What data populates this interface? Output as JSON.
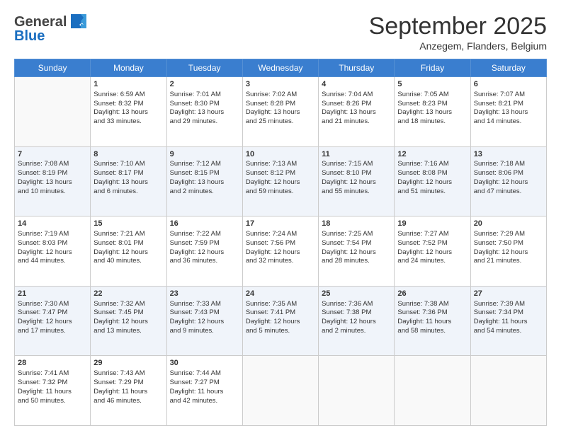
{
  "logo": {
    "text_general": "General",
    "text_blue": "Blue"
  },
  "title": "September 2025",
  "subtitle": "Anzegem, Flanders, Belgium",
  "days_of_week": [
    "Sunday",
    "Monday",
    "Tuesday",
    "Wednesday",
    "Thursday",
    "Friday",
    "Saturday"
  ],
  "weeks": [
    [
      {
        "day": "",
        "info": ""
      },
      {
        "day": "1",
        "info": "Sunrise: 6:59 AM\nSunset: 8:32 PM\nDaylight: 13 hours\nand 33 minutes."
      },
      {
        "day": "2",
        "info": "Sunrise: 7:01 AM\nSunset: 8:30 PM\nDaylight: 13 hours\nand 29 minutes."
      },
      {
        "day": "3",
        "info": "Sunrise: 7:02 AM\nSunset: 8:28 PM\nDaylight: 13 hours\nand 25 minutes."
      },
      {
        "day": "4",
        "info": "Sunrise: 7:04 AM\nSunset: 8:26 PM\nDaylight: 13 hours\nand 21 minutes."
      },
      {
        "day": "5",
        "info": "Sunrise: 7:05 AM\nSunset: 8:23 PM\nDaylight: 13 hours\nand 18 minutes."
      },
      {
        "day": "6",
        "info": "Sunrise: 7:07 AM\nSunset: 8:21 PM\nDaylight: 13 hours\nand 14 minutes."
      }
    ],
    [
      {
        "day": "7",
        "info": "Sunrise: 7:08 AM\nSunset: 8:19 PM\nDaylight: 13 hours\nand 10 minutes."
      },
      {
        "day": "8",
        "info": "Sunrise: 7:10 AM\nSunset: 8:17 PM\nDaylight: 13 hours\nand 6 minutes."
      },
      {
        "day": "9",
        "info": "Sunrise: 7:12 AM\nSunset: 8:15 PM\nDaylight: 13 hours\nand 2 minutes."
      },
      {
        "day": "10",
        "info": "Sunrise: 7:13 AM\nSunset: 8:12 PM\nDaylight: 12 hours\nand 59 minutes."
      },
      {
        "day": "11",
        "info": "Sunrise: 7:15 AM\nSunset: 8:10 PM\nDaylight: 12 hours\nand 55 minutes."
      },
      {
        "day": "12",
        "info": "Sunrise: 7:16 AM\nSunset: 8:08 PM\nDaylight: 12 hours\nand 51 minutes."
      },
      {
        "day": "13",
        "info": "Sunrise: 7:18 AM\nSunset: 8:06 PM\nDaylight: 12 hours\nand 47 minutes."
      }
    ],
    [
      {
        "day": "14",
        "info": "Sunrise: 7:19 AM\nSunset: 8:03 PM\nDaylight: 12 hours\nand 44 minutes."
      },
      {
        "day": "15",
        "info": "Sunrise: 7:21 AM\nSunset: 8:01 PM\nDaylight: 12 hours\nand 40 minutes."
      },
      {
        "day": "16",
        "info": "Sunrise: 7:22 AM\nSunset: 7:59 PM\nDaylight: 12 hours\nand 36 minutes."
      },
      {
        "day": "17",
        "info": "Sunrise: 7:24 AM\nSunset: 7:56 PM\nDaylight: 12 hours\nand 32 minutes."
      },
      {
        "day": "18",
        "info": "Sunrise: 7:25 AM\nSunset: 7:54 PM\nDaylight: 12 hours\nand 28 minutes."
      },
      {
        "day": "19",
        "info": "Sunrise: 7:27 AM\nSunset: 7:52 PM\nDaylight: 12 hours\nand 24 minutes."
      },
      {
        "day": "20",
        "info": "Sunrise: 7:29 AM\nSunset: 7:50 PM\nDaylight: 12 hours\nand 21 minutes."
      }
    ],
    [
      {
        "day": "21",
        "info": "Sunrise: 7:30 AM\nSunset: 7:47 PM\nDaylight: 12 hours\nand 17 minutes."
      },
      {
        "day": "22",
        "info": "Sunrise: 7:32 AM\nSunset: 7:45 PM\nDaylight: 12 hours\nand 13 minutes."
      },
      {
        "day": "23",
        "info": "Sunrise: 7:33 AM\nSunset: 7:43 PM\nDaylight: 12 hours\nand 9 minutes."
      },
      {
        "day": "24",
        "info": "Sunrise: 7:35 AM\nSunset: 7:41 PM\nDaylight: 12 hours\nand 5 minutes."
      },
      {
        "day": "25",
        "info": "Sunrise: 7:36 AM\nSunset: 7:38 PM\nDaylight: 12 hours\nand 2 minutes."
      },
      {
        "day": "26",
        "info": "Sunrise: 7:38 AM\nSunset: 7:36 PM\nDaylight: 11 hours\nand 58 minutes."
      },
      {
        "day": "27",
        "info": "Sunrise: 7:39 AM\nSunset: 7:34 PM\nDaylight: 11 hours\nand 54 minutes."
      }
    ],
    [
      {
        "day": "28",
        "info": "Sunrise: 7:41 AM\nSunset: 7:32 PM\nDaylight: 11 hours\nand 50 minutes."
      },
      {
        "day": "29",
        "info": "Sunrise: 7:43 AM\nSunset: 7:29 PM\nDaylight: 11 hours\nand 46 minutes."
      },
      {
        "day": "30",
        "info": "Sunrise: 7:44 AM\nSunset: 7:27 PM\nDaylight: 11 hours\nand 42 minutes."
      },
      {
        "day": "",
        "info": ""
      },
      {
        "day": "",
        "info": ""
      },
      {
        "day": "",
        "info": ""
      },
      {
        "day": "",
        "info": ""
      }
    ]
  ]
}
